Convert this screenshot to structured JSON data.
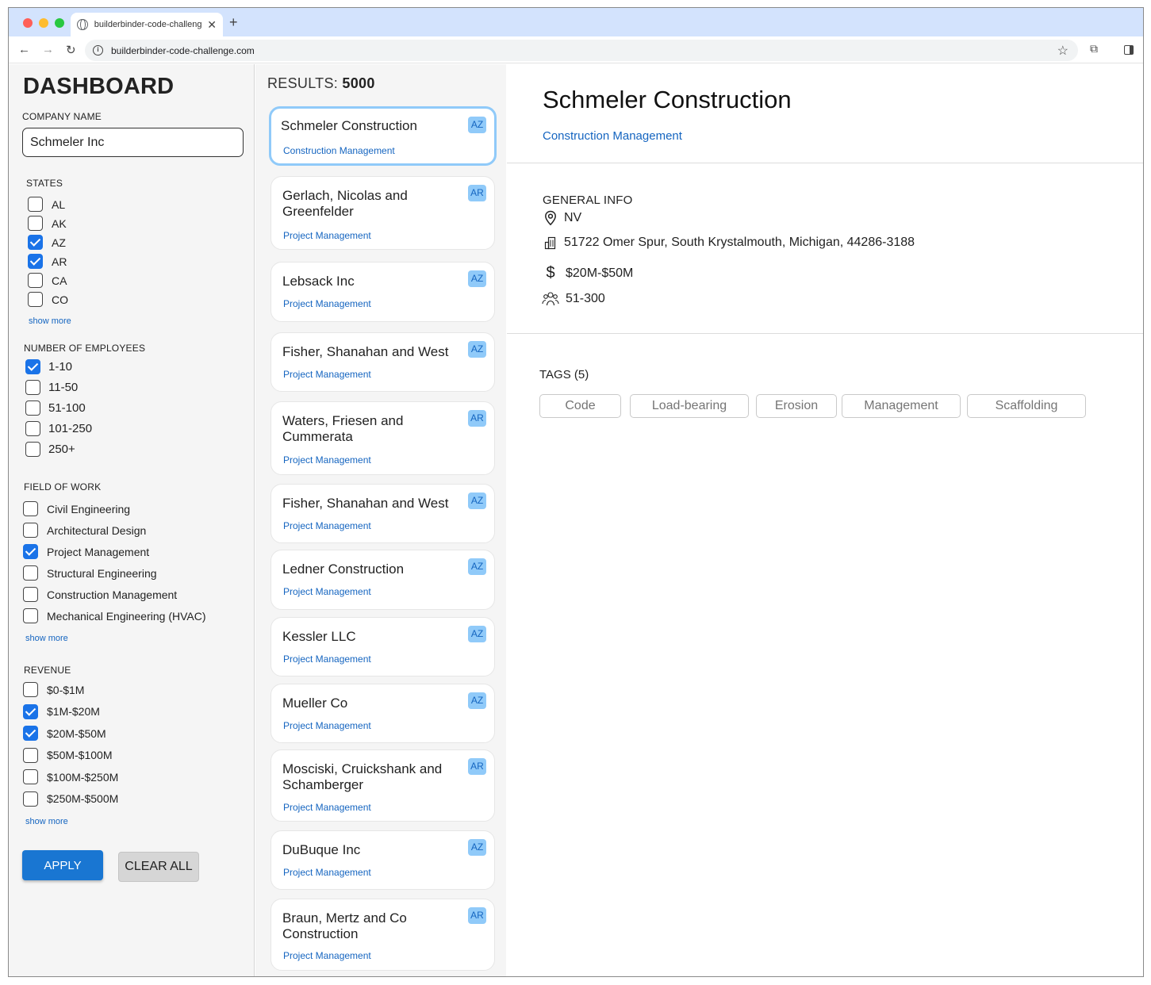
{
  "browser": {
    "tab_title": "builderbinder-code-challenge.com",
    "url": "builderbinder-code-challenge.com"
  },
  "sidebar": {
    "title": "DASHBOARD",
    "company_name_label": "COMPANY NAME",
    "company_name_value": "Schmeler Inc",
    "states_label": "STATES",
    "states": [
      {
        "label": "AL",
        "checked": false
      },
      {
        "label": "AK",
        "checked": false
      },
      {
        "label": "AZ",
        "checked": true
      },
      {
        "label": "AR",
        "checked": true
      },
      {
        "label": "CA",
        "checked": false
      },
      {
        "label": "CO",
        "checked": false
      }
    ],
    "employees_label": "NUMBER OF EMPLOYEES",
    "employees": [
      {
        "label": "1-10",
        "checked": true
      },
      {
        "label": "11-50",
        "checked": false
      },
      {
        "label": "51-100",
        "checked": false
      },
      {
        "label": "101-250",
        "checked": false
      },
      {
        "label": "250+",
        "checked": false
      }
    ],
    "field_label": "FIELD OF WORK",
    "fields": [
      {
        "label": "Civil Engineering",
        "checked": false
      },
      {
        "label": "Architectural Design",
        "checked": false
      },
      {
        "label": "Project Management",
        "checked": true
      },
      {
        "label": "Structural Engineering",
        "checked": false
      },
      {
        "label": "Construction Management",
        "checked": false
      },
      {
        "label": "Mechanical Engineering (HVAC)",
        "checked": false
      }
    ],
    "revenue_label": "REVENUE",
    "revenues": [
      {
        "label": "$0-$1M",
        "checked": false
      },
      {
        "label": "$1M-$20M",
        "checked": true
      },
      {
        "label": "$20M-$50M",
        "checked": true
      },
      {
        "label": "$50M-$100M",
        "checked": false
      },
      {
        "label": "$100M-$250M",
        "checked": false
      },
      {
        "label": "$250M-$500M",
        "checked": false
      }
    ],
    "show_more": "show more",
    "apply_label": "APPLY",
    "clear_label": "CLEAR ALL"
  },
  "results": {
    "label": "RESULTS:",
    "count": "5000",
    "items": [
      {
        "name": "Schmeler Construction",
        "field": "Construction Management",
        "state": "AZ"
      },
      {
        "name": "Gerlach, Nicolas and Greenfelder",
        "field": "Project Management",
        "state": "AR"
      },
      {
        "name": "Lebsack Inc",
        "field": "Project Management",
        "state": "AZ"
      },
      {
        "name": "Fisher, Shanahan and West",
        "field": "Project Management",
        "state": "AZ"
      },
      {
        "name": "Waters, Friesen and Cummerata",
        "field": "Project Management",
        "state": "AR"
      },
      {
        "name": "Fisher, Shanahan and West",
        "field": "Project Management",
        "state": "AZ"
      },
      {
        "name": "Ledner Construction",
        "field": "Project Management",
        "state": "AZ"
      },
      {
        "name": "Kessler LLC",
        "field": "Project Management",
        "state": "AZ"
      },
      {
        "name": "Mueller Co",
        "field": "Project Management",
        "state": "AZ"
      },
      {
        "name": "Mosciski, Cruickshank and Schamberger",
        "field": "Project Management",
        "state": "AR"
      },
      {
        "name": "DuBuque Inc",
        "field": "Project Management",
        "state": "AZ"
      },
      {
        "name": "Braun, Mertz and Co Construction",
        "field": "Project Management",
        "state": "AR"
      }
    ]
  },
  "details": {
    "name": "Schmeler Construction",
    "field": "Construction Management",
    "general_info_label": "GENERAL INFO",
    "state": "NV",
    "address": "51722 Omer Spur, South Krystalmouth, Michigan, 44286-3188",
    "revenue": "$20M-$50M",
    "employees": "51-300",
    "tags_label": "TAGS (5)",
    "tags": [
      "Code",
      "Load-bearing",
      "Erosion",
      "Management",
      "Scaffolding"
    ]
  },
  "colors": {
    "accent": "#1976d2",
    "link": "#1565c0",
    "badge_bg": "#90caf9",
    "selected_border": "#90caf9"
  }
}
